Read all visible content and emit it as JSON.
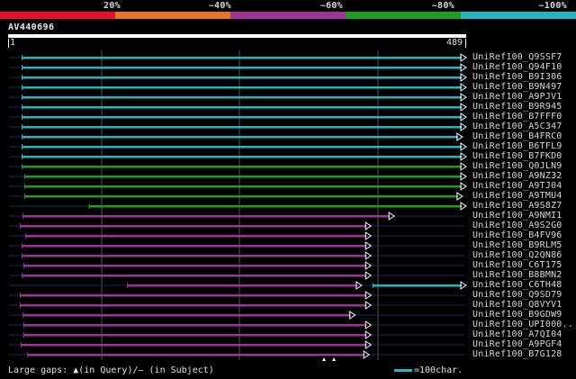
{
  "scale": {
    "labels": [
      "20%",
      "~40%",
      "~60%",
      "~80%",
      "~100%"
    ],
    "colors": [
      "#e8102a",
      "#e87320",
      "#a0309a",
      "#1e9e20",
      "#1fb7c4"
    ]
  },
  "query": {
    "name": "AV440696",
    "start": "1",
    "end": "489",
    "length": 489
  },
  "colors": {
    "cyan": "#1fb7c4",
    "green": "#1e9e20",
    "purple": "#a0309a",
    "line": "#1a2a5a",
    "grid": "#555555"
  },
  "hits": [
    {
      "label": "UniRef100_Q9SSF7",
      "color": "cyan",
      "segs": [
        [
          14,
          489
        ]
      ],
      "arrow": true
    },
    {
      "label": "UniRef100_Q94F10",
      "color": "cyan",
      "segs": [
        [
          14,
          489
        ]
      ],
      "arrow": true
    },
    {
      "label": "UniRef100_B9I306",
      "color": "cyan",
      "segs": [
        [
          14,
          489
        ]
      ],
      "arrow": true
    },
    {
      "label": "UniRef100_B9N497",
      "color": "cyan",
      "segs": [
        [
          14,
          489
        ]
      ],
      "arrow": true
    },
    {
      "label": "UniRef100_A9PJV1",
      "color": "cyan",
      "segs": [
        [
          14,
          489
        ]
      ],
      "arrow": true
    },
    {
      "label": "UniRef100_B9R945",
      "color": "cyan",
      "segs": [
        [
          14,
          489
        ]
      ],
      "arrow": true
    },
    {
      "label": "UniRef100_B7FFF0",
      "color": "cyan",
      "segs": [
        [
          14,
          489
        ]
      ],
      "arrow": true
    },
    {
      "label": "UniRef100_A5C347",
      "color": "cyan",
      "segs": [
        [
          14,
          489
        ]
      ],
      "arrow": true
    },
    {
      "label": "UniRef100_B4FRC0",
      "color": "cyan",
      "segs": [
        [
          14,
          485
        ]
      ],
      "arrow": true
    },
    {
      "label": "UniRef100_B6TFL9",
      "color": "cyan",
      "segs": [
        [
          14,
          489
        ]
      ],
      "arrow": true
    },
    {
      "label": "UniRef100_B7FKD0",
      "color": "cyan",
      "segs": [
        [
          14,
          489
        ]
      ],
      "arrow": true
    },
    {
      "label": "UniRef100_Q0JLN9",
      "color": "green",
      "segs": [
        [
          14,
          489
        ]
      ],
      "arrow": true
    },
    {
      "label": "UniRef100_A9NZ32",
      "color": "green",
      "segs": [
        [
          17,
          489
        ]
      ],
      "arrow": true
    },
    {
      "label": "UniRef100_A9TJ04",
      "color": "green",
      "segs": [
        [
          17,
          489
        ]
      ],
      "arrow": true
    },
    {
      "label": "UniRef100_A9TMU4",
      "color": "green",
      "segs": [
        [
          17,
          485
        ]
      ],
      "arrow": true
    },
    {
      "label": "UniRef100_A9S8Z7",
      "color": "green",
      "segs": [
        [
          86,
          489
        ]
      ],
      "arrow": true
    },
    {
      "label": "UniRef100_A9NMI1",
      "color": "purple",
      "segs": [
        [
          15,
          412
        ]
      ],
      "arrow": true
    },
    {
      "label": "UniRef100_A9S2G0",
      "color": "purple",
      "segs": [
        [
          12,
          387
        ]
      ],
      "arrow": true
    },
    {
      "label": "UniRef100_B4FV96",
      "color": "purple",
      "segs": [
        [
          18,
          387
        ]
      ],
      "arrow": true
    },
    {
      "label": "UniRef100_B9RLM5",
      "color": "purple",
      "segs": [
        [
          14,
          387
        ]
      ],
      "arrow": true
    },
    {
      "label": "UniRef100_Q2QN86",
      "color": "purple",
      "segs": [
        [
          14,
          387
        ]
      ],
      "arrow": true
    },
    {
      "label": "UniRef100_C6T175",
      "color": "purple",
      "segs": [
        [
          16,
          387
        ]
      ],
      "arrow": true
    },
    {
      "label": "UniRef100_B8BMN2",
      "color": "purple",
      "segs": [
        [
          14,
          387
        ]
      ],
      "arrow": true
    },
    {
      "label": "UniRef100_C6TH48",
      "color": "purple",
      "segs": [
        [
          127,
          377
        ],
        [
          390,
          489
        ]
      ],
      "seg2color": "cyan",
      "arrow": true
    },
    {
      "label": "UniRef100_Q9SD79",
      "color": "purple",
      "segs": [
        [
          12,
          387
        ]
      ],
      "arrow": true
    },
    {
      "label": "UniRef100_Q8VYV1",
      "color": "purple",
      "segs": [
        [
          12,
          387
        ]
      ],
      "arrow": true
    },
    {
      "label": "UniRef100_B9GDW9",
      "color": "purple",
      "segs": [
        [
          15,
          370
        ]
      ],
      "arrow": true
    },
    {
      "label": "UniRef100_UPI000..",
      "color": "purple",
      "segs": [
        [
          16,
          387
        ]
      ],
      "arrow": true
    },
    {
      "label": "UniRef100_A7QI04",
      "color": "purple",
      "segs": [
        [
          16,
          387
        ]
      ],
      "arrow": true
    },
    {
      "label": "UniRef100_A9PGF4",
      "color": "purple",
      "segs": [
        [
          13,
          387
        ]
      ],
      "arrow": true
    },
    {
      "label": "UniRef100_B7G128",
      "color": "purple",
      "segs": [
        [
          20,
          385
        ]
      ],
      "arrow": true
    }
  ],
  "legend": {
    "text": "Large gaps: ▲(in Query)/— (in Subject)",
    "scale": "=100char."
  }
}
